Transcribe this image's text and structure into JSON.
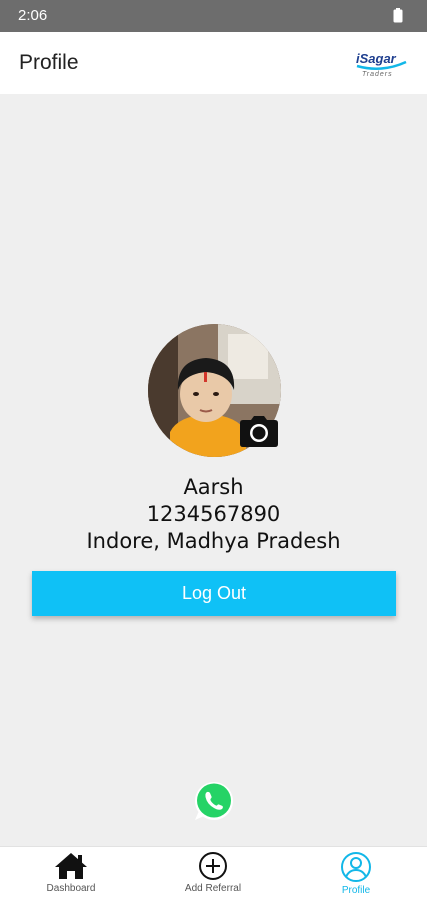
{
  "status_bar": {
    "time": "2:06",
    "icons": [
      "battery-icon"
    ]
  },
  "header": {
    "title": "Profile",
    "logo_text": "iSagar",
    "logo_subtext": "Traders"
  },
  "profile": {
    "name": "Aarsh",
    "phone": "1234567890",
    "location": "Indore, Madhya Pradesh",
    "avatar_icon": "profile-photo",
    "edit_photo_icon": "camera-icon"
  },
  "actions": {
    "logout_label": "Log Out",
    "whatsapp_icon": "whatsapp-icon"
  },
  "bottom_nav": {
    "items": [
      {
        "label": "Dashboard",
        "icon": "home-icon",
        "active": false
      },
      {
        "label": "Add Referral",
        "icon": "plus-circle-icon",
        "active": false
      },
      {
        "label": "Profile",
        "icon": "user-circle-icon",
        "active": true
      }
    ]
  },
  "colors": {
    "accent": "#0fc1f6",
    "active_nav": "#12b7e8",
    "status_bar": "#6d6d6d",
    "background": "#efefef"
  }
}
